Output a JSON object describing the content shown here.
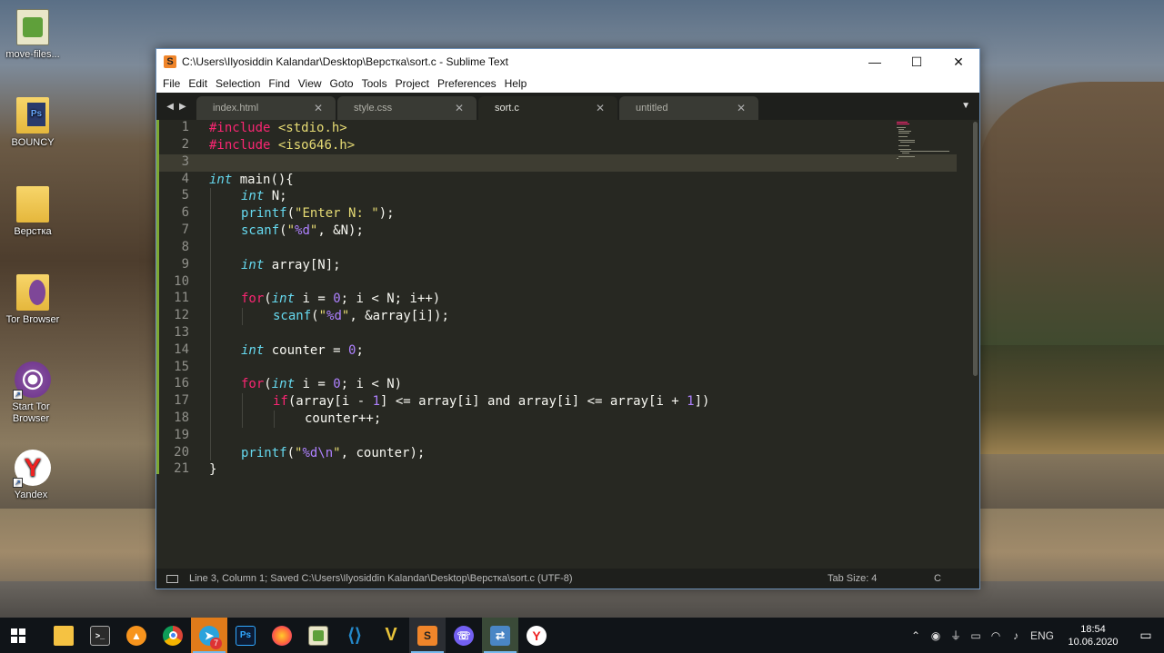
{
  "desktop": {
    "icons": [
      {
        "label": "move-files..."
      },
      {
        "label": "BOUNCY"
      },
      {
        "label": "Верстка"
      },
      {
        "label": "Tor Browser"
      },
      {
        "label": "Start Tor Browser"
      },
      {
        "label": "Yandex"
      }
    ]
  },
  "window": {
    "title": "C:\\Users\\Ilyosiddin Kalandar\\Desktop\\Верстка\\sort.c - Sublime Text",
    "controls": {
      "minimize": "—",
      "maximize": "☐",
      "close": "✕"
    },
    "menu": [
      "File",
      "Edit",
      "Selection",
      "Find",
      "View",
      "Goto",
      "Tools",
      "Project",
      "Preferences",
      "Help"
    ],
    "tabs": [
      {
        "label": "index.html",
        "active": false
      },
      {
        "label": "style.css",
        "active": false
      },
      {
        "label": "sort.c",
        "active": true
      },
      {
        "label": "untitled",
        "active": false
      }
    ],
    "line_numbers": [
      "1",
      "2",
      "3",
      "4",
      "5",
      "6",
      "7",
      "8",
      "9",
      "10",
      "11",
      "12",
      "13",
      "14",
      "15",
      "16",
      "17",
      "18",
      "19",
      "20",
      "21"
    ],
    "status": {
      "left": "Line 3, Column 1; Saved C:\\Users\\Ilyosiddin Kalandar\\Desktop\\Верстка\\sort.c (UTF-8)",
      "tab_size": "Tab Size: 4",
      "syntax": "C"
    }
  },
  "code": {
    "l1_a": "#include",
    "l1_b": " ",
    "l1_c": "<stdio.h>",
    "l2_a": "#include",
    "l2_b": " ",
    "l2_c": "<iso646.h>",
    "l4_type": "int",
    "l4_rest": " main(){",
    "l5_type": "int",
    "l5_rest": " N;",
    "l6_fn": "printf",
    "l6_p": "(",
    "l6_str": "\"Enter N: \"",
    "l6_end": ");",
    "l7_fn": "scanf",
    "l7_p": "(",
    "l7_s1": "\"",
    "l7_fmt": "%d",
    "l7_s2": "\"",
    "l7_end": ", &N);",
    "l9_type": "int",
    "l9_rest": " array[N];",
    "l11_for": "for",
    "l11_p": "(",
    "l11_type": "int",
    "l11_mid": " i = ",
    "l11_num": "0",
    "l11_end": "; i < N; i++)",
    "l12_fn": "scanf",
    "l12_p": "(",
    "l12_s1": "\"",
    "l12_fmt": "%d",
    "l12_s2": "\"",
    "l12_end": ", &array[i]);",
    "l14_type": "int",
    "l14_mid": " counter = ",
    "l14_num": "0",
    "l14_end": ";",
    "l16_for": "for",
    "l16_p": "(",
    "l16_type": "int",
    "l16_mid": " i = ",
    "l16_num": "0",
    "l16_end": "; i < N)",
    "l17_if": "if",
    "l17_a": "(array[i - ",
    "l17_n1": "1",
    "l17_b": "] <= array[i] and array[i] <= array[i + ",
    "l17_n2": "1",
    "l17_c": "])",
    "l18": "counter++;",
    "l20_fn": "printf",
    "l20_p": "(",
    "l20_s1": "\"",
    "l20_fmt": "%d\\n",
    "l20_s2": "\"",
    "l20_end": ", counter);",
    "l21": "}"
  },
  "taskbar": {
    "apps": [
      "Start",
      "File Explorer",
      "Terminal",
      "Avast",
      "Chrome",
      "Telegram",
      "Photoshop",
      "Firefox",
      "Notepad++",
      "VS Code",
      "Vim",
      "Sublime Text",
      "Viber",
      "Network",
      "Yandex"
    ],
    "telegram_badge": "7",
    "language": "ENG",
    "time": "18:54",
    "date": "10.06.2020"
  },
  "colors": {
    "editor_bg": "#272822",
    "keyword": "#f92672",
    "type": "#66d9ef",
    "string": "#e6db74",
    "number": "#ae81ff"
  }
}
